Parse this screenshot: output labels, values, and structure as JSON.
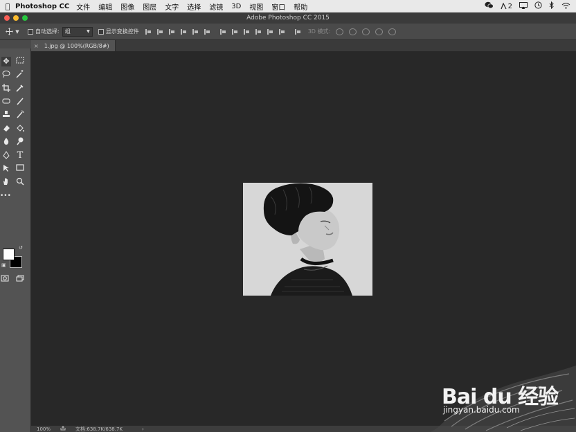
{
  "menubar": {
    "app_name": "Photoshop CC",
    "items": [
      "文件",
      "编辑",
      "图像",
      "图层",
      "文字",
      "选择",
      "滤镜",
      "3D",
      "视图",
      "窗口",
      "帮助"
    ],
    "badge_count": "2"
  },
  "window": {
    "title": "Adobe Photoshop CC 2015"
  },
  "options_bar": {
    "auto_select_label": "自动选择:",
    "auto_select_value": "组",
    "show_transform_label": "显示变换控件",
    "mode_3d_label": "3D 模式:"
  },
  "document_tab": {
    "label": "1.jpg @ 100%(RGB/8#)",
    "close": "×"
  },
  "status_bar": {
    "zoom": "100%",
    "doc_size": "文档:638.7K/638.7K"
  },
  "watermark": {
    "logo": "Bai du 经验",
    "url": "jingyan.baidu.com"
  },
  "colors": {
    "foreground": "#ffffff",
    "background": "#000000"
  }
}
